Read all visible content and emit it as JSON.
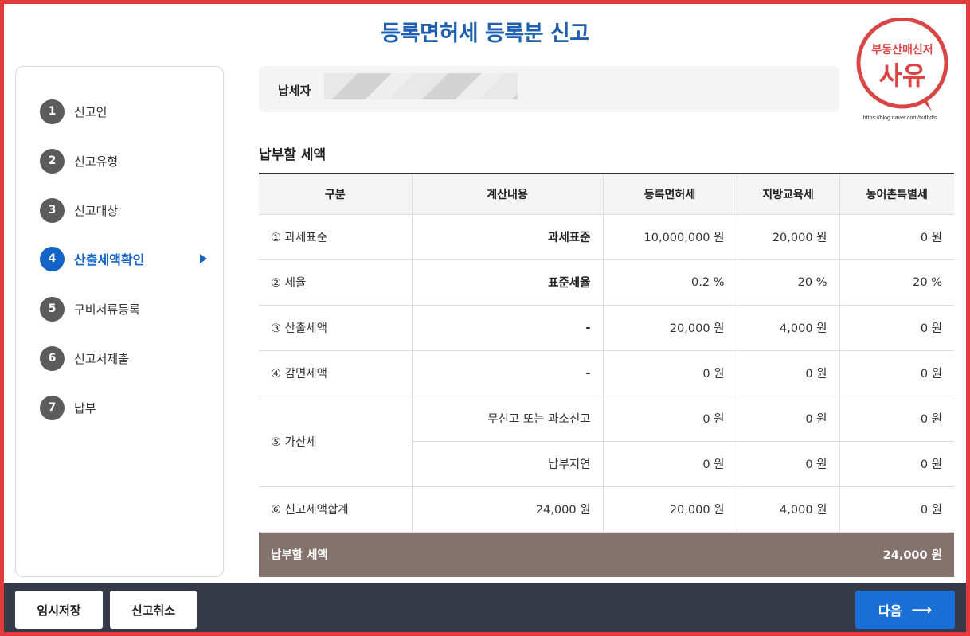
{
  "title": "등록면허세 등록분 신고",
  "stamp": {
    "line1": "부동산매신저",
    "line2": "사유",
    "url": "https://blog.naver.com/tkdbdls",
    "color": "#d94545"
  },
  "steps": [
    {
      "num": "1",
      "label": "신고인"
    },
    {
      "num": "2",
      "label": "신고유형"
    },
    {
      "num": "3",
      "label": "신고대상"
    },
    {
      "num": "4",
      "label": "산출세액확인",
      "active": true
    },
    {
      "num": "5",
      "label": "구비서류등록"
    },
    {
      "num": "6",
      "label": "신고서제출"
    },
    {
      "num": "7",
      "label": "납부"
    }
  ],
  "payer": {
    "label": "납세자"
  },
  "section_title": "납부할 세액",
  "table": {
    "headers": [
      "구분",
      "계산내용",
      "등록면허세",
      "지방교육세",
      "농어촌특별세"
    ],
    "rows": [
      {
        "cat": "① 과세표준",
        "calc": "과세표준",
        "reg": "10,000,000 원",
        "edu": "20,000 원",
        "rural": "0 원"
      },
      {
        "cat": "② 세율",
        "calc": "표준세율",
        "reg": "0.2 %",
        "edu": "20 %",
        "rural": "20 %"
      },
      {
        "cat": "③ 산출세액",
        "calc": "-",
        "reg": "20,000 원",
        "edu": "4,000 원",
        "rural": "0 원"
      },
      {
        "cat": "④ 감면세액",
        "calc": "-",
        "reg": "0 원",
        "edu": "0 원",
        "rural": "0 원"
      },
      {
        "cat": "⑤ 가산세",
        "calc": "무신고 또는 과소신고",
        "reg": "0 원",
        "edu": "0 원",
        "rural": "0 원"
      },
      {
        "cat": "",
        "calc": "납부지연",
        "reg": "0 원",
        "edu": "0 원",
        "rural": "0 원"
      },
      {
        "cat": "⑥ 신고세액합계",
        "calc": "24,000 원",
        "reg": "20,000 원",
        "edu": "4,000 원",
        "rural": "0 원"
      }
    ],
    "total": {
      "label": "납부할 세액",
      "value": "24,000 원"
    }
  },
  "buttons": {
    "temp_save": "임시저장",
    "cancel": "신고취소",
    "next": "다음"
  },
  "colors": {
    "accent": "#1464c8",
    "title": "#1f5fb0",
    "total_row": "#84736c",
    "bottom_bar": "#363a48",
    "next_button": "#1a6fd6",
    "frame": "#e33b3b"
  }
}
